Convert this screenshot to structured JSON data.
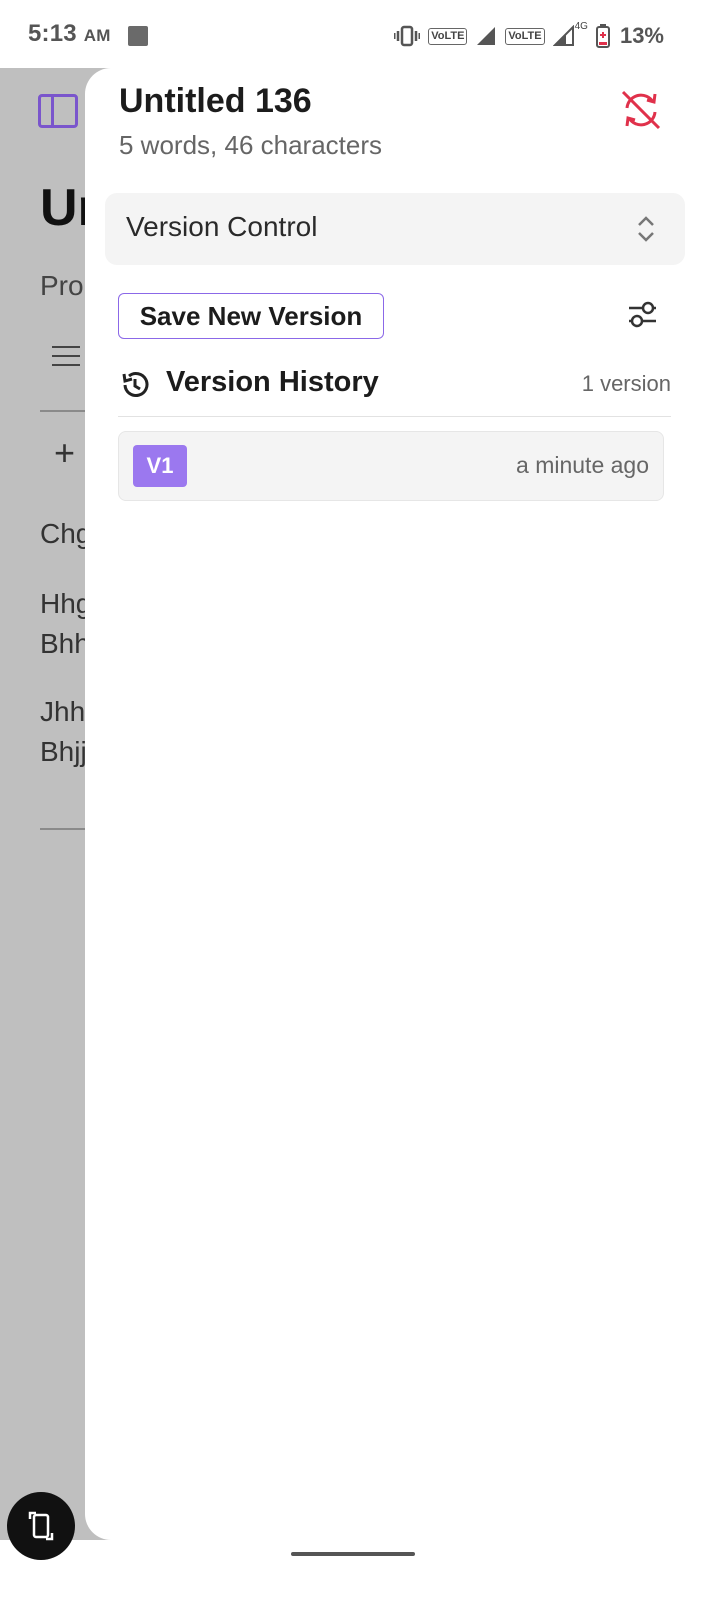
{
  "status_bar": {
    "time": "5:13",
    "ampm": "AM",
    "volte1": "VoLTE",
    "volte2": "VoLTE",
    "network": "4G",
    "battery": "13%"
  },
  "background_doc": {
    "title_fragment": "Un",
    "subtitle_fragment": "Pro",
    "line1": "Chg",
    "line2a": "Hhg",
    "line2b": "Bhh",
    "line3a": "Jhh",
    "line3b": "Bhjj"
  },
  "panel": {
    "doc_title": "Untitled 136",
    "doc_stats": "5 words, 46 characters",
    "select_label": "Version Control",
    "save_label": "Save New Version",
    "history_title": "Version History",
    "history_count": "1 version",
    "versions": [
      {
        "badge": "V1",
        "time": "a minute ago"
      }
    ]
  },
  "colors": {
    "accent": "#9b78ef",
    "accent_border": "#8b68e8",
    "sync_off": "#e0314b",
    "overlay": "#bfbfbf"
  }
}
